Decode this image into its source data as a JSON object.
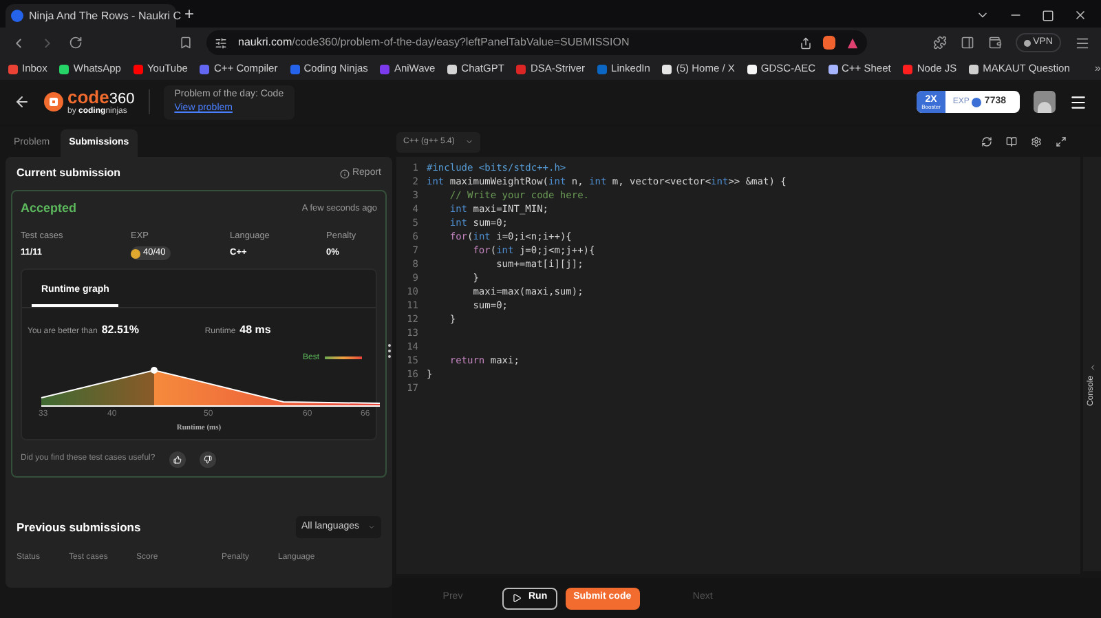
{
  "browser": {
    "tabs": [
      {
        "title": "Ninja And The Rows - Naukri C",
        "selected": true
      }
    ],
    "new_tab": "+",
    "url": {
      "domain": "naukri.com",
      "path": "/code360/problem-of-the-day/easy?leftPanelTabValue=SUBMISSION"
    },
    "vpn": "VPN"
  },
  "bookmarks": {
    "items": [
      {
        "label": "Inbox",
        "color": "#ea4335"
      },
      {
        "label": "WhatsApp",
        "color": "#25d366"
      },
      {
        "label": "YouTube",
        "color": "#ff0000"
      },
      {
        "label": "C++ Compiler",
        "color": "#6366f1"
      },
      {
        "label": "Coding Ninjas",
        "color": "#2563eb"
      },
      {
        "label": "AniWave",
        "color": "#7c3aed"
      },
      {
        "label": "ChatGPT",
        "color": "#d4d4d4"
      },
      {
        "label": "DSA-Striver",
        "color": "#dc2626"
      },
      {
        "label": "LinkedIn",
        "color": "#0a66c2"
      },
      {
        "label": "(5) Home / X",
        "color": "#e5e5e5"
      },
      {
        "label": "GDSC-AEC",
        "color": "#f5f5f5"
      },
      {
        "label": "C++ Sheet",
        "color": "#a5b4fc"
      },
      {
        "label": "Node JS",
        "color": "#ff1f1f"
      },
      {
        "label": "MAKAUT Question",
        "color": "#cfcfcf"
      }
    ],
    "more": "»"
  },
  "header": {
    "logo": {
      "main": "code",
      "num": "360",
      "by": "by",
      "brand_bold": "coding",
      "brand": "ninjas"
    },
    "potd": "Problem of the day: Code",
    "view": "View problem",
    "booster": {
      "mult": "2X",
      "label": "Booster"
    },
    "exp_label": "EXP",
    "exp": "7738"
  },
  "left": {
    "tabs": [
      {
        "label": "Problem",
        "selected": false
      },
      {
        "label": "Submissions",
        "selected": true
      }
    ],
    "current": {
      "title": "Current submission",
      "report": "Report",
      "status": "Accepted",
      "time": "A few seconds ago",
      "stats": [
        {
          "label": "Test cases",
          "value": "11/11",
          "kind": "text"
        },
        {
          "label": "EXP",
          "value": "40/40",
          "kind": "coin"
        },
        {
          "label": "Language",
          "value": "C++",
          "kind": "text"
        },
        {
          "label": "Penalty",
          "value": "0%",
          "kind": "text"
        }
      ],
      "graph": {
        "tab": "Runtime graph",
        "better_label": "You are better than",
        "better": "82.51%",
        "runtime_label": "Runtime",
        "runtime": "48 ms",
        "legend": "Best",
        "x_ticks": [
          "33",
          "40",
          "50",
          "60",
          "66"
        ],
        "xlabel": "Runtime (ms)"
      },
      "feedback": "Did you find these test cases useful?"
    },
    "previous": {
      "title": "Previous submissions",
      "filter": "All languages",
      "columns": [
        "Status",
        "Test cases",
        "Score",
        "Penalty",
        "Language"
      ]
    }
  },
  "editor": {
    "language": "C++ (g++ 5.4)",
    "lines": [
      {
        "number": "1",
        "tokens": [
          {
            "t": "#include <bits/stdc++.h>",
            "kind": "preproc"
          }
        ]
      },
      {
        "number": "2",
        "tokens": [
          {
            "t": "int",
            "kind": "type"
          },
          {
            "t": " maximumWeightRow(",
            "kind": "plain"
          },
          {
            "t": "int",
            "kind": "type"
          },
          {
            "t": " n, ",
            "kind": "plain"
          },
          {
            "t": "int",
            "kind": "type"
          },
          {
            "t": " m, vector<vector<",
            "kind": "plain"
          },
          {
            "t": "int",
            "kind": "type"
          },
          {
            "t": ">> &mat) {",
            "kind": "plain"
          }
        ]
      },
      {
        "number": "3",
        "tokens": [
          {
            "t": "    // Write your code here.",
            "kind": "comment"
          }
        ]
      },
      {
        "number": "4",
        "tokens": [
          {
            "t": "    int",
            "kind": "type"
          },
          {
            "t": " maxi=INT_MIN;",
            "kind": "plain"
          }
        ]
      },
      {
        "number": "5",
        "tokens": [
          {
            "t": "    int",
            "kind": "type"
          },
          {
            "t": " sum=0;",
            "kind": "plain"
          }
        ]
      },
      {
        "number": "6",
        "tokens": [
          {
            "t": "    for",
            "kind": "control"
          },
          {
            "t": "(",
            "kind": "plain"
          },
          {
            "t": "int",
            "kind": "type"
          },
          {
            "t": " i=0;i<n;i++){",
            "kind": "plain"
          }
        ]
      },
      {
        "number": "7",
        "tokens": [
          {
            "t": "        for",
            "kind": "control"
          },
          {
            "t": "(",
            "kind": "plain"
          },
          {
            "t": "int",
            "kind": "type"
          },
          {
            "t": " j=0;j<m;j++){",
            "kind": "plain"
          }
        ]
      },
      {
        "number": "8",
        "tokens": [
          {
            "t": "            sum+=mat[i][j];",
            "kind": "plain"
          }
        ]
      },
      {
        "number": "9",
        "tokens": [
          {
            "t": "        }",
            "kind": "plain"
          }
        ]
      },
      {
        "number": "10",
        "tokens": [
          {
            "t": "        maxi=max(maxi,sum);",
            "kind": "plain"
          }
        ]
      },
      {
        "number": "11",
        "tokens": [
          {
            "t": "        sum=0;",
            "kind": "plain"
          }
        ]
      },
      {
        "number": "12",
        "tokens": [
          {
            "t": "    }",
            "kind": "plain"
          }
        ]
      },
      {
        "number": "13"
      },
      {
        "number": "14"
      },
      {
        "number": "15",
        "tokens": [
          {
            "t": "    return",
            "kind": "control"
          },
          {
            "t": " maxi;",
            "kind": "plain"
          }
        ]
      },
      {
        "number": "16",
        "tokens": [
          {
            "t": "}",
            "kind": "plain"
          }
        ]
      },
      {
        "number": "17"
      }
    ],
    "buttons": [
      {
        "label": "Prev",
        "kind": "nav",
        "disabled": true
      },
      {
        "label": "Run",
        "kind": "run",
        "disabled": false
      },
      {
        "label": "Submit code",
        "kind": "submit",
        "disabled": false
      },
      {
        "label": "Next",
        "kind": "nav",
        "disabled": true
      }
    ],
    "console": "Console"
  }
}
